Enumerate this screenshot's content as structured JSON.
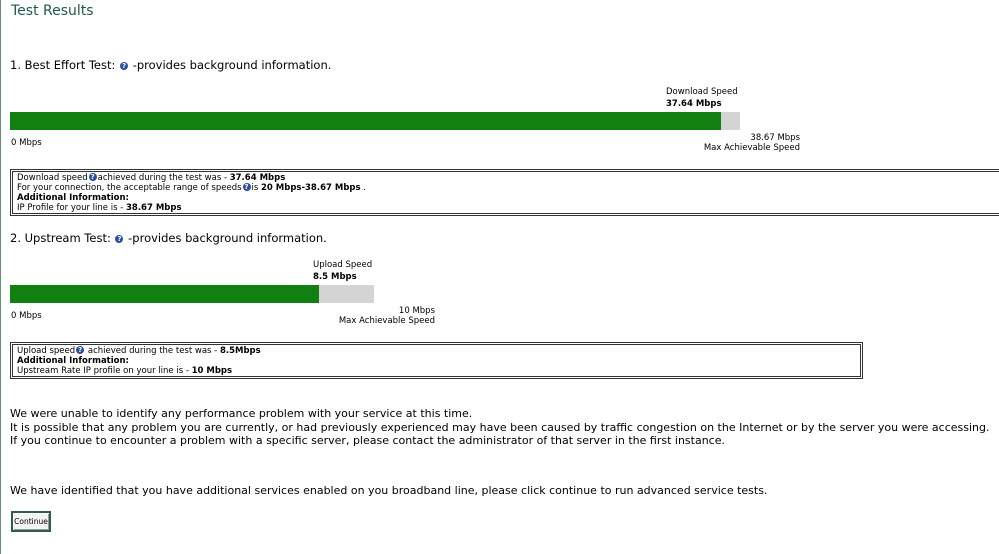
{
  "page": {
    "title": "Test Results"
  },
  "best_effort": {
    "heading_prefix": "1. Best Effort Test:",
    "heading_suffix": "-provides background information.",
    "speed_label": "Download Speed",
    "speed_value": "37.64 Mbps",
    "min_label": "0 Mbps",
    "max_value": "38.67 Mbps",
    "max_label": "Max Achievable Speed",
    "fill_fraction": 0.9734,
    "info": {
      "line1_prefix": "Download speed",
      "line1_mid": "achieved during the test was - ",
      "line1_value": "37.64 Mbps",
      "line2_prefix": "For your connection, the acceptable range of speeds",
      "line2_mid": "is ",
      "line2_value": "20 Mbps-38.67 Mbps",
      "line2_suffix": " .",
      "line3": "Additional Information:",
      "line4_prefix": "IP Profile for your line is - ",
      "line4_value": "38.67 Mbps"
    }
  },
  "upstream": {
    "heading_prefix": "2. Upstream Test:",
    "heading_suffix": "-provides background information.",
    "speed_label": "Upload Speed",
    "speed_value": "8.5 Mbps",
    "min_label": "0 Mbps",
    "max_value": "10 Mbps",
    "max_label": "Max Achievable Speed",
    "fill_fraction": 0.85,
    "info": {
      "line1_prefix": "Upload speed",
      "line1_mid": " achieved during the test was - ",
      "line1_value": "8.5Mbps",
      "line2": "Additional Information:",
      "line3_prefix": "Upstream Rate IP profile on your line is - ",
      "line3_value": "10 Mbps"
    }
  },
  "messages": {
    "line1": "We were unable to identify any performance problem with your service at this time.",
    "line2": "It is possible that any problem you are currently, or had previously experienced may have been caused by traffic congestion on the Internet or by the server you were accessing.",
    "line3": "If you continue to encounter a problem with a specific server, please contact the administrator of that server in the first instance.",
    "line4": "We have identified that you have additional services enabled on you broadband line, please click continue to run advanced service tests."
  },
  "buttons": {
    "continue": "Continue"
  },
  "colors": {
    "bar_fill": "#118011",
    "bar_track": "#d4d4d4",
    "title": "#1f5a4a",
    "help_icon": "#2d4fa0"
  },
  "icons": {
    "help": "question-circle-icon"
  }
}
